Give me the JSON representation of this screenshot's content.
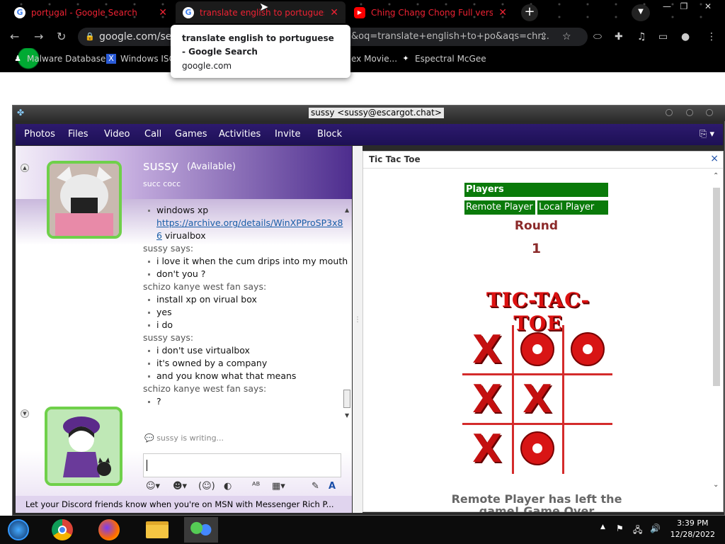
{
  "browser": {
    "tabs": [
      {
        "title": "portugal - Google Search",
        "icon": "google-icon"
      },
      {
        "title": "translate english to portuguese",
        "icon": "google-icon"
      },
      {
        "title": "Ching Chang Chong Full version (C",
        "icon": "youtube-icon"
      }
    ],
    "new_tab_label": "+",
    "url": "google.com/sea",
    "url_query": "&oq=translate+english+to+po&aqs=chr...",
    "bookmarks": [
      "Malware Database",
      "Windows ISO",
      "ex Movie...",
      "Espectral McGee"
    ],
    "tooltip": {
      "title": "translate english to portuguese - Google Search",
      "url": "google.com"
    }
  },
  "messenger": {
    "window_title": "sussy <sussy@escargot.chat>",
    "menu": [
      "Photos",
      "Files",
      "Video",
      "Call",
      "Games",
      "Activities",
      "Invite",
      "Block"
    ],
    "contact": {
      "name": "sussy",
      "status": "(Available)",
      "personal_message": "succ cocc"
    },
    "chat": [
      {
        "type": "li",
        "text": "windows xp"
      },
      {
        "type": "link",
        "text": "https://archive.org/details/WinXPProSP3x86",
        "suffix": " virualbox"
      },
      {
        "type": "say",
        "text": "sussy says:"
      },
      {
        "type": "li",
        "text": "i love it when the cum drips into my mouth"
      },
      {
        "type": "li",
        "text": "don't you ?"
      },
      {
        "type": "say",
        "text": "schizo kanye west fan says:"
      },
      {
        "type": "li",
        "text": "install xp on virual box"
      },
      {
        "type": "li",
        "text": "yes"
      },
      {
        "type": "li",
        "text": "i do"
      },
      {
        "type": "say",
        "text": "sussy says:"
      },
      {
        "type": "li",
        "text": "i don't use virtualbox"
      },
      {
        "type": "li",
        "text": "it's owned by a company"
      },
      {
        "type": "li",
        "text": "and you know what that means"
      },
      {
        "type": "say",
        "text": "schizo kanye west fan says:"
      },
      {
        "type": "li",
        "text": "?"
      }
    ],
    "typing_status": "sussy is writing...",
    "ad_text": "Let your Discord friends know when you're on MSN with Messenger Rich P...",
    "colors": {
      "menu_bg": "#2d1a6e",
      "accent_green": "#6fd04a"
    }
  },
  "game": {
    "title": "Tic Tac Toe",
    "close_label": "×",
    "players_label": "Players",
    "remote_player": "Remote Player",
    "local_player": "Local Player",
    "round_label": "Round",
    "round_number": "1",
    "logo_text": "TIC-TAC-TOE",
    "board": [
      "X",
      "O",
      "O",
      "X",
      "X",
      "",
      "X",
      "O",
      ""
    ],
    "status": "Remote Player has left the game! Game Over"
  },
  "taskbar": {
    "apps": [
      "media-player-icon",
      "chrome-icon",
      "firefox-icon",
      "file-explorer-icon",
      "messenger-icon"
    ],
    "time": "3:39 PM",
    "date": "12/28/2022"
  }
}
